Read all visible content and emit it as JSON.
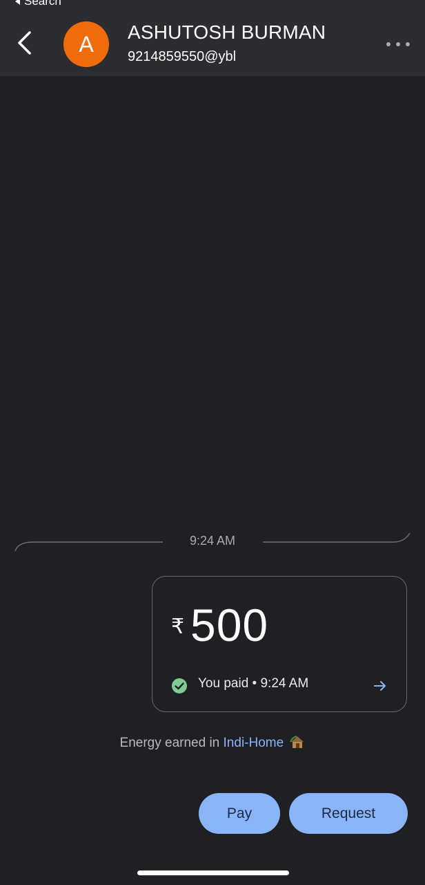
{
  "status_bar": {
    "back_label": "Search"
  },
  "header": {
    "avatar_initial": "A",
    "avatar_color": "#f06b0a",
    "name": "ASHUTOSH BURMAN",
    "upi_id": "9214859550@ybl"
  },
  "conversation": {
    "timestamp": "9:24 AM",
    "payment": {
      "currency_symbol": "₹",
      "amount": "500",
      "status": "You paid • 9:24 AM",
      "status_color": "#81c995"
    },
    "energy": {
      "prefix": "Energy earned in ",
      "link": "Indi-Home",
      "icon": "hut-icon"
    }
  },
  "actions": {
    "pay_label": "Pay",
    "request_label": "Request",
    "accent_color": "#8ab4f8"
  }
}
